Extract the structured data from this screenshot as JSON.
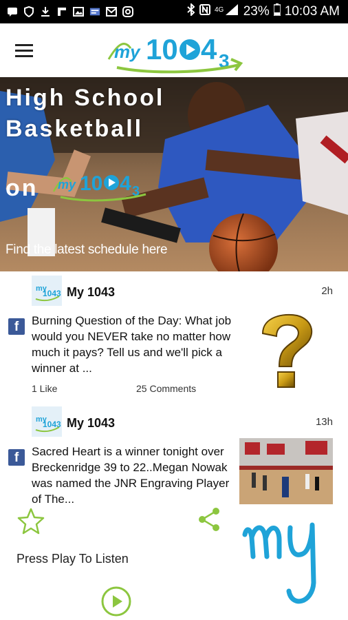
{
  "status_bar": {
    "battery": "23%",
    "time": "10:03 AM"
  },
  "app_bar": {
    "logo_text": "my1043"
  },
  "hero": {
    "title_line1": "High School",
    "title_line2": "Basketball",
    "on_text": "on",
    "cta": "Find the latest schedule here"
  },
  "posts": [
    {
      "author": "My 1043",
      "time": "2h",
      "text": "Burning Question of the Day: What job would you NEVER take no matter how much it pays? Tell us and we'll pick a winner at ...",
      "likes": "1 Like",
      "comments": "25 Comments"
    },
    {
      "author": "My 1043",
      "time": "13h",
      "text": "Sacred Heart is a winner tonight over Breckenridge 39 to 22..Megan Nowak was named the JNR Engraving Player of The..."
    }
  ],
  "bottom": {
    "press_play": "Press Play To Listen",
    "my_logo_text": "My"
  },
  "colors": {
    "accent_green": "#8cc63f",
    "brand_blue": "#1fa3d8",
    "facebook": "#3b5998"
  }
}
